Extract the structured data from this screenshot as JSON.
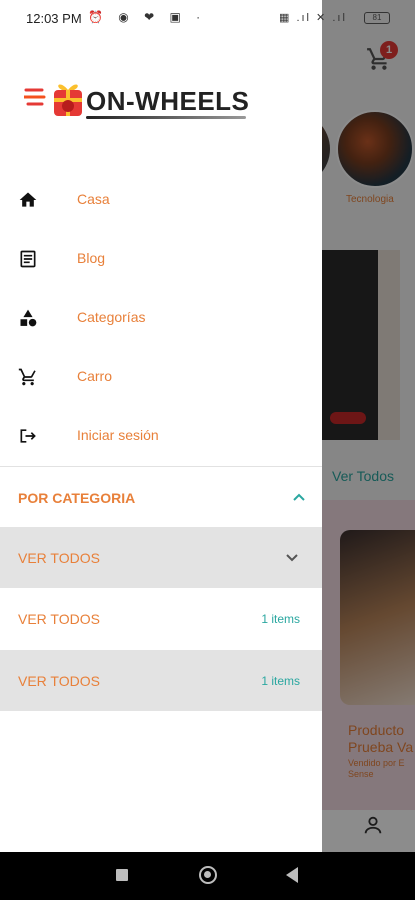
{
  "status_bar": {
    "time": "12:03 PM",
    "left_icons": "⏰ ◉ ❤ ▣ ·",
    "right_icons": "▦ .ıl ✕ .ıl",
    "battery": "81"
  },
  "background": {
    "cart_badge": "1",
    "category_label": "Tecnologia",
    "see_all": "Ver Todos",
    "product_title": "Producto Prueba Va",
    "product_sub": "Vendido por E Sense"
  },
  "logo": {
    "text": "ON-WHEELS"
  },
  "menu": {
    "items": [
      {
        "label": "Casa",
        "icon": "home-icon"
      },
      {
        "label": "Blog",
        "icon": "article-icon"
      },
      {
        "label": "Categorías",
        "icon": "category-icon"
      },
      {
        "label": "Carro",
        "icon": "cart-icon"
      },
      {
        "label": "Iniciar sesión",
        "icon": "login-icon"
      }
    ]
  },
  "categories": {
    "title": "POR CATEGORIA",
    "rows": [
      {
        "label": "VER TODOS",
        "count": ""
      },
      {
        "label": "VER TODOS",
        "count": "1 items"
      },
      {
        "label": "VER TODOS",
        "count": "1 items"
      }
    ]
  },
  "colors": {
    "accent": "#e8803a",
    "teal": "#2aa7a0",
    "shaded_row": "#e3e3e3"
  }
}
